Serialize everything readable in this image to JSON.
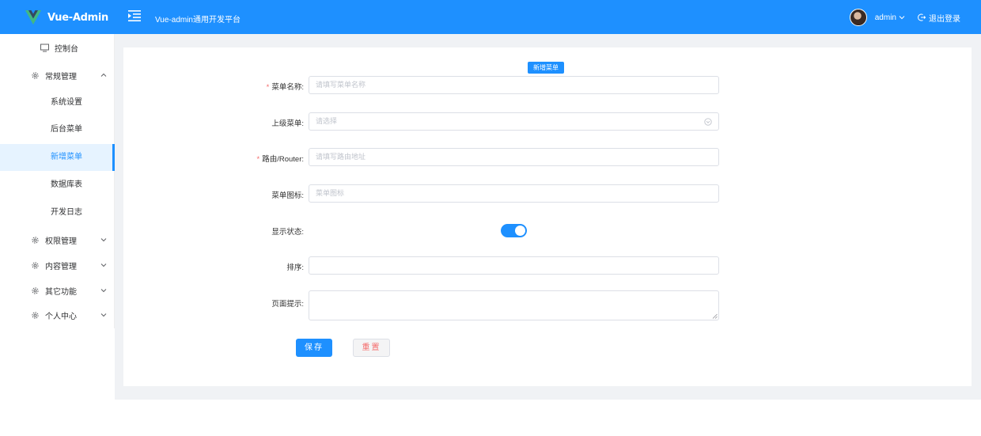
{
  "header": {
    "logo_text": "Vue-Admin",
    "platform_title": "Vue-admin通用开发平台",
    "user_name": "admin",
    "logout_label": "退出登录",
    "colors": {
      "primary": "#1e90ff",
      "danger": "#f56c6c"
    }
  },
  "sidebar": {
    "dashboard": "控制台",
    "groups": [
      {
        "label": "常规管理",
        "icon": "gear-icon",
        "expanded": true
      },
      {
        "label": "权限管理",
        "icon": "gear-icon",
        "expanded": false
      },
      {
        "label": "内容管理",
        "icon": "gear-icon",
        "expanded": false
      },
      {
        "label": "其它功能",
        "icon": "gear-icon",
        "expanded": false
      },
      {
        "label": "个人中心",
        "icon": "gear-icon",
        "expanded": false
      }
    ],
    "sub_items": [
      {
        "label": "系统设置",
        "active": false
      },
      {
        "label": "后台菜单",
        "active": false
      },
      {
        "label": "新增菜单",
        "active": true
      },
      {
        "label": "数据库表",
        "active": false
      },
      {
        "label": "开发日志",
        "active": false
      }
    ]
  },
  "form": {
    "title": "新增菜单",
    "fields": {
      "menu_name": {
        "label": "菜单名称:",
        "required": true,
        "placeholder": "请填写菜单名称",
        "value": ""
      },
      "parent_menu": {
        "label": "上级菜单:",
        "required": false,
        "placeholder": "请选择",
        "value": ""
      },
      "router": {
        "label": "路由/Router:",
        "required": true,
        "placeholder": "请填写路由地址",
        "value": ""
      },
      "menu_icon": {
        "label": "菜单图标:",
        "required": false,
        "placeholder": "菜单图标",
        "value": ""
      },
      "display_status": {
        "label": "显示状态:",
        "value": true
      },
      "sort": {
        "label": "排序:",
        "value": ""
      },
      "page_hint": {
        "label": "页面提示:",
        "value": ""
      }
    },
    "required_mark": "*",
    "save_label": "保存",
    "reset_label": "重置"
  }
}
